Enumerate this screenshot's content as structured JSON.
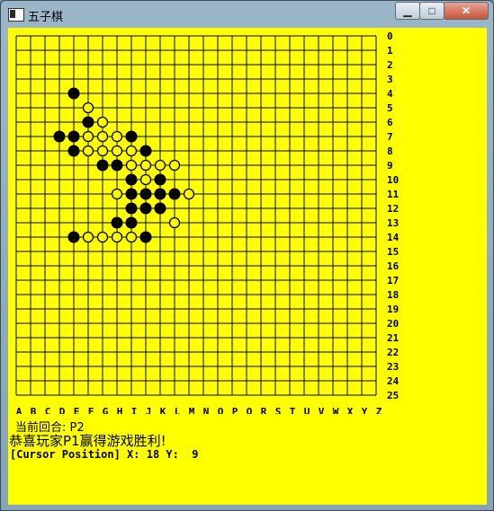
{
  "window": {
    "title": "五子棋",
    "controls": {
      "minimize": "▁",
      "maximize": "□",
      "close": "✕"
    }
  },
  "board": {
    "size": 26,
    "columns": [
      "A",
      "B",
      "C",
      "D",
      "E",
      "F",
      "G",
      "H",
      "I",
      "J",
      "K",
      "L",
      "M",
      "N",
      "O",
      "P",
      "Q",
      "R",
      "S",
      "T",
      "U",
      "V",
      "W",
      "X",
      "Y",
      "Z"
    ],
    "rows": [
      "0",
      "1",
      "2",
      "3",
      "4",
      "5",
      "6",
      "7",
      "8",
      "9",
      "10",
      "11",
      "12",
      "13",
      "14",
      "15",
      "16",
      "17",
      "18",
      "19",
      "20",
      "21",
      "22",
      "23",
      "24",
      "25"
    ],
    "black_stones": [
      [
        4,
        4
      ],
      [
        5,
        6
      ],
      [
        3,
        7
      ],
      [
        4,
        7
      ],
      [
        8,
        7
      ],
      [
        4,
        8
      ],
      [
        9,
        8
      ],
      [
        6,
        9
      ],
      [
        7,
        9
      ],
      [
        8,
        10
      ],
      [
        10,
        10
      ],
      [
        8,
        11
      ],
      [
        9,
        11
      ],
      [
        10,
        11
      ],
      [
        11,
        11
      ],
      [
        8,
        12
      ],
      [
        9,
        12
      ],
      [
        10,
        12
      ],
      [
        7,
        13
      ],
      [
        8,
        13
      ],
      [
        4,
        14
      ],
      [
        9,
        14
      ]
    ],
    "white_stones": [
      [
        5,
        5
      ],
      [
        6,
        6
      ],
      [
        5,
        7
      ],
      [
        6,
        7
      ],
      [
        7,
        7
      ],
      [
        5,
        8
      ],
      [
        6,
        8
      ],
      [
        7,
        8
      ],
      [
        8,
        8
      ],
      [
        8,
        9
      ],
      [
        9,
        9
      ],
      [
        10,
        9
      ],
      [
        11,
        9
      ],
      [
        9,
        10
      ],
      [
        7,
        11
      ],
      [
        12,
        11
      ],
      [
        11,
        13
      ],
      [
        5,
        14
      ],
      [
        6,
        14
      ],
      [
        7,
        14
      ],
      [
        8,
        14
      ]
    ]
  },
  "status": {
    "current_turn": "当前回合: P2",
    "win_message": "恭喜玩家P1赢得游戏胜利!",
    "cursor_position": "[Cursor Position] X: 18 Y:  9"
  },
  "colors": {
    "background": "#ffff00",
    "grid": "#000000",
    "black_stone": "#000000",
    "white_stone": "#ffff00"
  }
}
